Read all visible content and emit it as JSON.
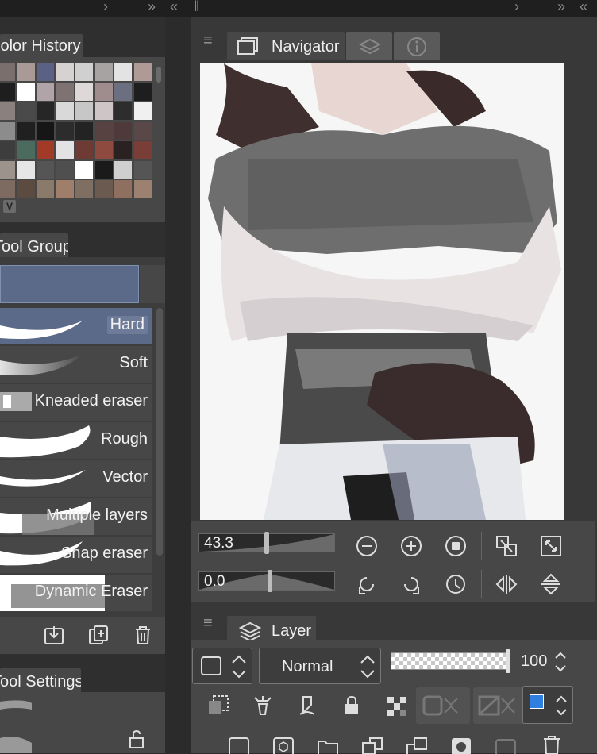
{
  "color_history": {
    "title": "Color History",
    "footer_badge": "V",
    "swatch_colors": [
      "#7a6f6c",
      "#a99a98",
      "#5a6185",
      "#d7d2d2",
      "#d0d0d0",
      "#a8a3a3",
      "#e3e3e3",
      "#b09a96",
      "#1e1e1e",
      "#ffffff",
      "#b0a4a8",
      "#7f7272",
      "#ded8d8",
      "#9e8d8c",
      "#6c6f80",
      "#1e1e1e",
      "#8a807d",
      "#4a4a4a",
      "#262626",
      "#d9d9d9",
      "#c7c7c7",
      "#cec6c6",
      "#2d2d2d",
      "#f0f0f0",
      "#8c8c8c",
      "#202020",
      "#161616",
      "#2c2c2c",
      "#232323",
      "#574141",
      "#4e3a3a",
      "#5a4848",
      "#3d3d3d",
      "#4b6b5e",
      "#a23a28",
      "#e3e3e3",
      "#6d3b33",
      "#8e4a3f",
      "#2a2121",
      "#7a3e38",
      "#9c948c",
      "#e6e6e6",
      "#555555",
      "#4f4f4f",
      "#ffffff",
      "#1a1a1a",
      "#cfcfcf",
      "#555555",
      "#7d6a60",
      "#5b4b40",
      "#8a7a6a",
      "#a07f6a",
      "#7f6f62",
      "#6a5a50",
      "#8f7060",
      "#9c8070"
    ]
  },
  "tool_group": {
    "title": "Tool Group",
    "brushes": [
      {
        "label": "Hard",
        "selected": true
      },
      {
        "label": "Soft",
        "selected": false
      },
      {
        "label": "Kneaded eraser",
        "selected": false
      },
      {
        "label": "Rough",
        "selected": false
      },
      {
        "label": "Vector",
        "selected": false
      },
      {
        "label": "Multiple layers",
        "selected": false
      },
      {
        "label": "Snap eraser",
        "selected": false
      },
      {
        "label": "Dynamic Eraser",
        "selected": false
      }
    ]
  },
  "tool_settings": {
    "title": "Tool Settings"
  },
  "navigator": {
    "title": "Navigator",
    "zoom_value": "43.3",
    "rotation_value": "0.0"
  },
  "layer": {
    "title": "Layer",
    "blend_mode": "Normal",
    "opacity": "100"
  },
  "colors": {
    "accent_selected": "#5c6a8a",
    "panel": "#474747",
    "layer_color_main": "#2f7fe0"
  }
}
